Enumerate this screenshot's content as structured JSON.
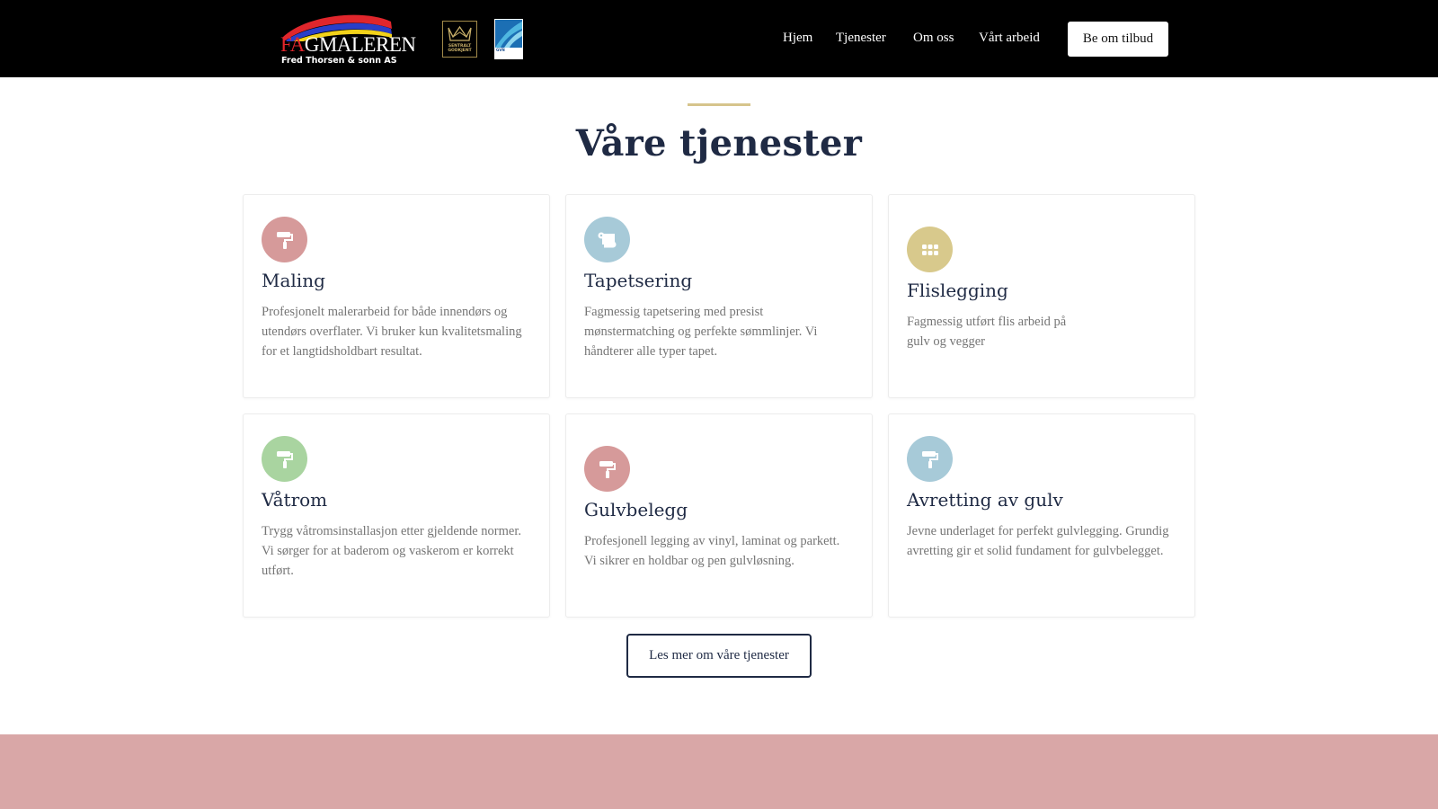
{
  "header": {
    "logo": {
      "word_fa": "FA",
      "word_rest": "GMALEREN",
      "subtitle": "Fred Thorsen & sonn AS"
    },
    "badges": {
      "sentralt_line1": "SENTRALT",
      "sentralt_line2": "GODKJENT",
      "gvn": "GVN"
    },
    "nav": [
      {
        "label": "Hjem"
      },
      {
        "label": "Tjenester"
      },
      {
        "label": "Om oss"
      },
      {
        "label": "Vårt arbeid"
      }
    ],
    "cta_label": "Be om tilbud"
  },
  "services": {
    "title": "Våre tjenester",
    "items": [
      {
        "title": "Maling",
        "text": "Profesjonelt malerarbeid for både innendørs og utendørs overflater. Vi bruker kun kvalitetsmaling for et langtidsholdbart resultat.",
        "icon": "paint-roller-icon",
        "color": "#d69a9a"
      },
      {
        "title": "Tapetsering",
        "text": "Fagmessig tapetsering med presist mønstermatching og perfekte sømmlinjer. Vi håndterer alle typer tapet.",
        "icon": "scroll-icon",
        "color": "#a7cad8"
      },
      {
        "title": "Flislegging",
        "text": "Fagmessig utført flis arbeid på gulv og vegger",
        "icon": "grid-dots-icon",
        "color": "#d8c98c"
      },
      {
        "title": "Våtrom",
        "text": "Trygg våtromsinstallasjon etter gjeldende normer. Vi sørger for at baderom og vaskerom er korrekt utført.",
        "icon": "paint-roller-icon",
        "color": "#a9d4a0"
      },
      {
        "title": "Gulvbelegg",
        "text": "Profesjonell legging av vinyl, laminat og parkett. Vi sikrer en holdbar og pen gulvløsning.",
        "icon": "paint-roller-icon",
        "color": "#d69a9a"
      },
      {
        "title": "Avretting av gulv",
        "text": "Jevne underlaget for perfekt gulvlegging. Grundig avretting gir et solid fundament for gulvbelegget.",
        "icon": "paint-roller-icon",
        "color": "#a7cad8"
      }
    ],
    "more_label": "Les mer om våre tjenester"
  },
  "colors": {
    "accent_line": "#d6c48c",
    "pink_band": "#d9a7a7",
    "heading": "#1f2a44"
  }
}
